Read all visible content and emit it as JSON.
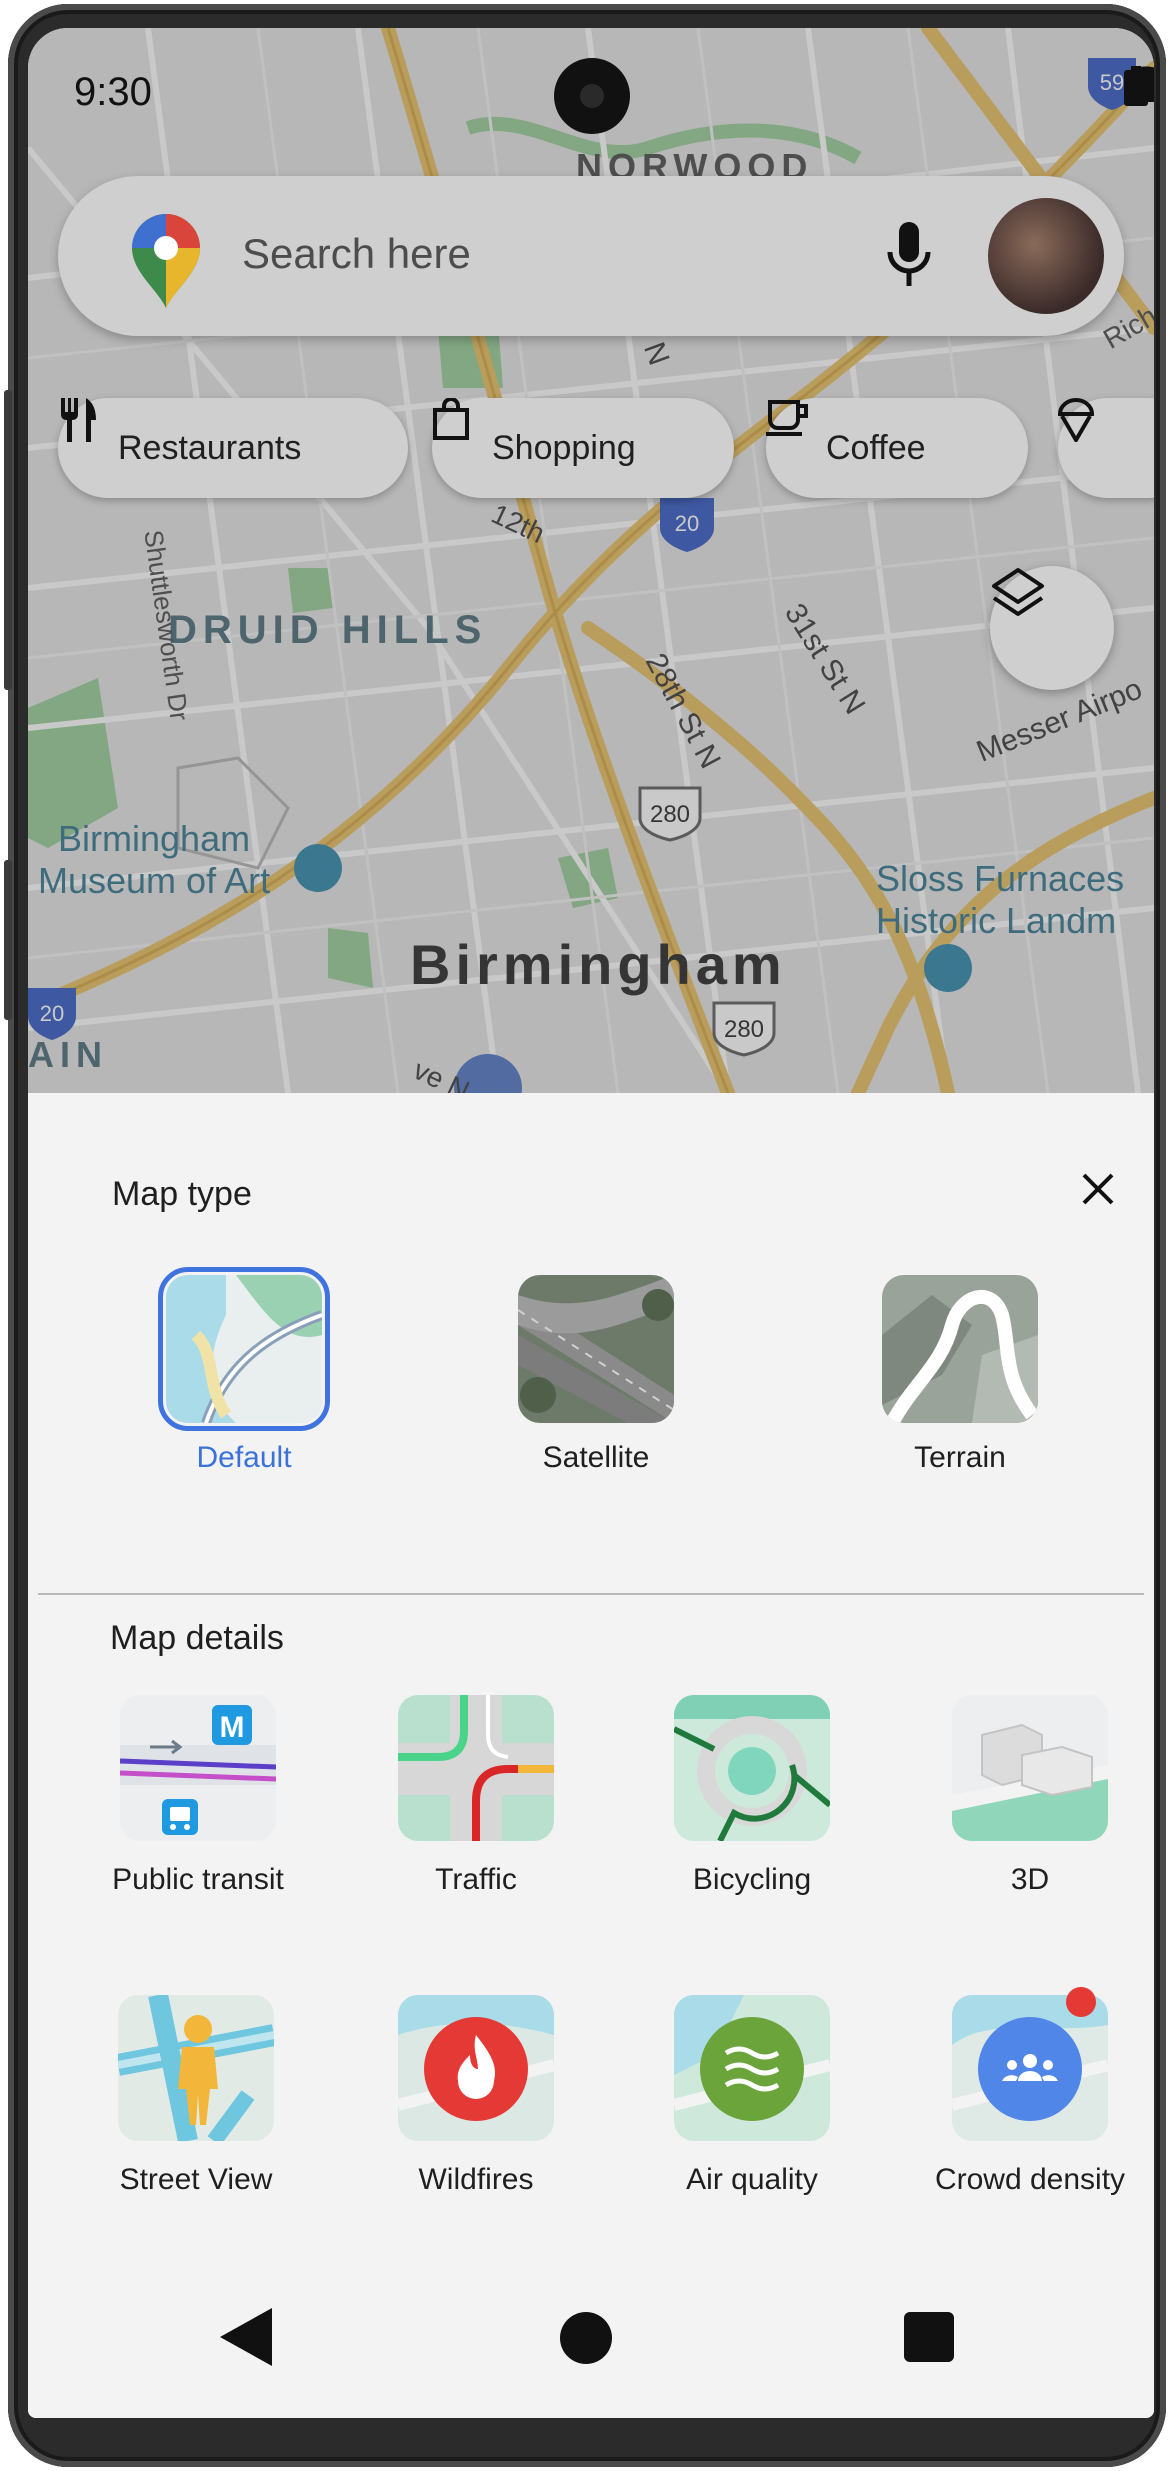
{
  "status_bar": {
    "time": "9:30"
  },
  "search": {
    "placeholder": "Search here"
  },
  "chips": [
    {
      "label": "Restaurants",
      "icon": "fork-knife-icon"
    },
    {
      "label": "Shopping",
      "icon": "shopping-bag-icon"
    },
    {
      "label": "Coffee",
      "icon": "coffee-cup-icon"
    },
    {
      "label": "",
      "icon": "ice-cream-icon"
    }
  ],
  "map_labels": {
    "norwood": "NORWOOD",
    "druid_hills": "DRUID HILLS",
    "shuttlesworth": "Shuttlesworth Dr",
    "street_31st": "31st St N",
    "street_28th": "28th St N",
    "messer": "Messer Airpo",
    "museum": "Birmingham\nMuseum of Art",
    "sloss": "Sloss Furnaces\nHistoric Landm",
    "city": "Birmingham",
    "ain": "AIN",
    "rich": "Rich",
    "street_12th": "12th",
    "i20_a": "20",
    "i20_b": "20",
    "us280_a": "280",
    "us280_b": "280",
    "i59": "59",
    "ave_n": "ve N",
    "partial_n": "N"
  },
  "sheet": {
    "map_type_title": "Map type",
    "map_types": [
      {
        "label": "Default",
        "selected": true
      },
      {
        "label": "Satellite",
        "selected": false
      },
      {
        "label": "Terrain",
        "selected": false
      }
    ],
    "map_details_title": "Map details",
    "details": [
      {
        "label": "Public transit"
      },
      {
        "label": "Traffic"
      },
      {
        "label": "Bicycling"
      },
      {
        "label": "3D"
      },
      {
        "label": "Street View"
      },
      {
        "label": "Wildfires"
      },
      {
        "label": "Air quality"
      },
      {
        "label": "Crowd density"
      }
    ],
    "transit_badge": "M"
  },
  "colors": {
    "accent": "#3f74e0",
    "wildfire": "#e53935",
    "air_quality": "#6aa43a",
    "crowd": "#4f86e8",
    "notification_dot": "#e53935"
  }
}
